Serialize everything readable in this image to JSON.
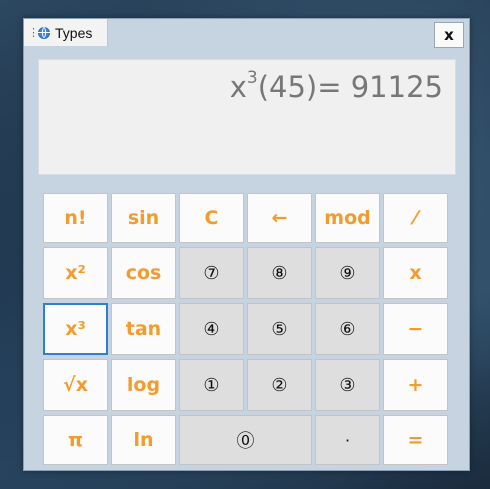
{
  "window": {
    "tab_title": "Types",
    "close_label": "x"
  },
  "display": {
    "base": "x",
    "exponent": "3",
    "expression": "(45)= 91125"
  },
  "keys": [
    {
      "label": "n!",
      "type": "fn"
    },
    {
      "label": "sin",
      "type": "fn"
    },
    {
      "label": "C",
      "type": "fn"
    },
    {
      "label": "←",
      "type": "fn"
    },
    {
      "label": "mod",
      "type": "fn"
    },
    {
      "label": "⁄",
      "type": "fn"
    },
    {
      "label": "x²",
      "type": "fn"
    },
    {
      "label": "cos",
      "type": "fn"
    },
    {
      "label": "⑦",
      "type": "num"
    },
    {
      "label": "⑧",
      "type": "num"
    },
    {
      "label": "⑨",
      "type": "num"
    },
    {
      "label": "x",
      "type": "fn"
    },
    {
      "label": "x³",
      "type": "fn",
      "focused": true
    },
    {
      "label": "tan",
      "type": "fn"
    },
    {
      "label": "④",
      "type": "num"
    },
    {
      "label": "⑤",
      "type": "num"
    },
    {
      "label": "⑥",
      "type": "num"
    },
    {
      "label": "−",
      "type": "fn"
    },
    {
      "label": "√x",
      "type": "fn"
    },
    {
      "label": "log",
      "type": "fn"
    },
    {
      "label": "①",
      "type": "num"
    },
    {
      "label": "②",
      "type": "num"
    },
    {
      "label": "③",
      "type": "num"
    },
    {
      "label": "+",
      "type": "fn"
    },
    {
      "label": "π",
      "type": "fn"
    },
    {
      "label": "ln",
      "type": "fn"
    },
    {
      "label": "⓪",
      "type": "num",
      "wide": true
    },
    {
      "label": "·",
      "type": "num"
    },
    {
      "label": "=",
      "type": "fn"
    }
  ],
  "colors": {
    "function_key_text": "#f39c2c",
    "number_key_background": "#dedede",
    "focus_border": "#2f7fd1",
    "window_background": "#c6d3e0"
  },
  "icons": [
    "grip-icon",
    "globe-icon"
  ]
}
